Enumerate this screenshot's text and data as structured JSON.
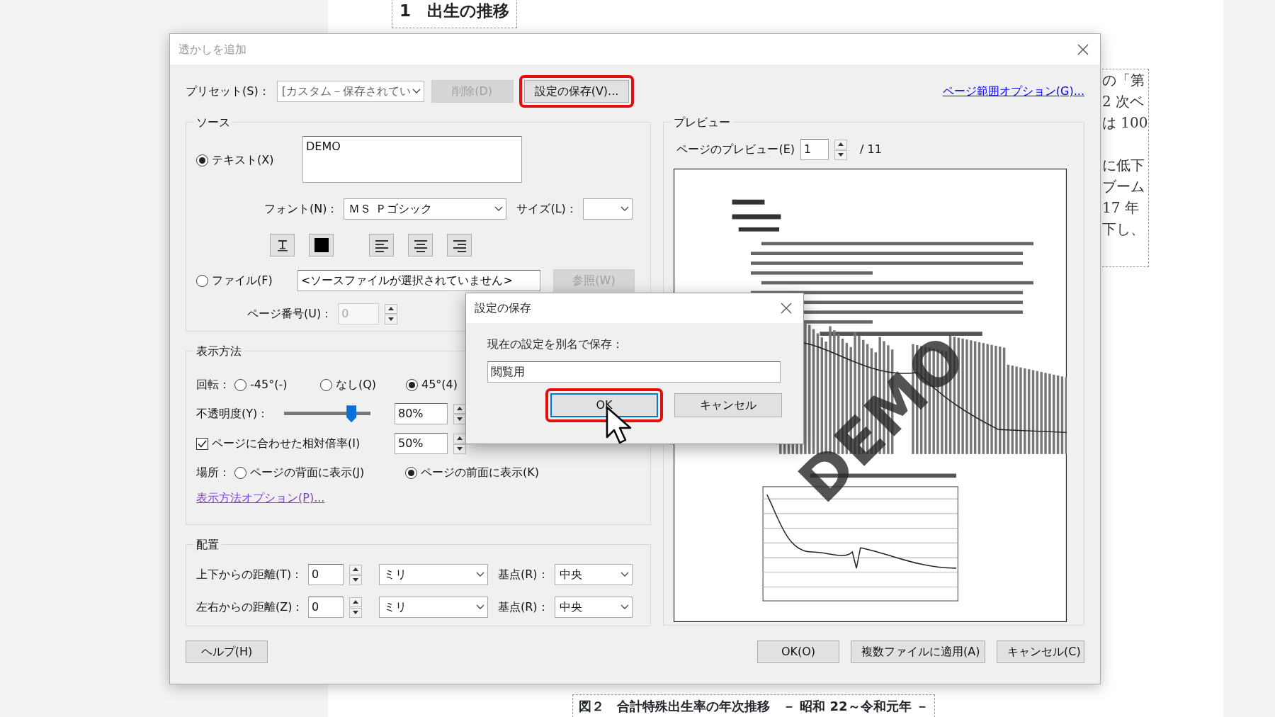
{
  "document": {
    "heading": "1　出生の推移",
    "side_paragraphs": [
      [
        "の「第",
        "2 次ベ",
        "は 100"
      ],
      [
        "に低下",
        "ブーム",
        "17 年",
        "下し、"
      ]
    ],
    "caption": "図２　合計特殊出生率の年次推移　－ 昭和 22～令和元年 －"
  },
  "dialog": {
    "title": "透かしを追加",
    "preset": {
      "label": "プリセット(S)：",
      "value": "[カスタム－保存されてい"
    },
    "toolbar_buttons": [
      {
        "label": "削除(D)",
        "disabled": true,
        "highlighted": false
      },
      {
        "label": "設定の保存(V)...",
        "disabled": false,
        "highlighted": true
      }
    ],
    "page_range_link": "ページ範囲オプション(G)...",
    "source": {
      "title": "ソース",
      "text_option": {
        "label": "テキスト(X)",
        "selected": true
      },
      "text_value": "DEMO",
      "font": {
        "label": "フォント(N)：",
        "value": "ＭＳ Ｐゴシック"
      },
      "size_label": "サイズ(L)：",
      "file_option": {
        "label": "ファイル(F)",
        "selected": false
      },
      "file_value": "<ソースファイルが選択されていません>",
      "browse_button": {
        "label": "参照(W)",
        "disabled": true
      },
      "page_number": {
        "label": "ページ番号(U)：",
        "value": "0",
        "disabled": true
      }
    },
    "appearance": {
      "title": "表示方法",
      "rotation_label": "回転：",
      "rotation_options": [
        {
          "label": "-45°(-)",
          "selected": false
        },
        {
          "label": "なし(Q)",
          "selected": false
        },
        {
          "label": "45°(4)",
          "selected": true
        }
      ],
      "opacity": {
        "label": "不透明度(Y)：",
        "level": 0.78,
        "value": "80%"
      },
      "scale": {
        "label": "ページに合わせた相対倍率(I)",
        "checked": true,
        "value": "50%"
      },
      "location_label": "場所：",
      "location_options": [
        {
          "label": "ページの背面に表示(J)",
          "selected": false
        },
        {
          "label": "ページの前面に表示(K)",
          "selected": true
        }
      ],
      "options_link": "表示方法オプション(P)..."
    },
    "position": {
      "title": "配置",
      "rows": [
        {
          "label": "上下からの距離(T)：",
          "value": "0",
          "unit": "ミリ",
          "anchor_label": "基点(R)：",
          "anchor": "中央"
        },
        {
          "label": "左右からの距離(Z)：",
          "value": "0",
          "unit": "ミリ",
          "anchor_label": "基点(R)：",
          "anchor": "中央"
        }
      ]
    },
    "preview": {
      "title": "プレビュー",
      "page_label": "ページのプレビュー(E)",
      "page": "1",
      "total": "/ 11",
      "watermark": "DEMO"
    },
    "help_button": "ヘルプ(H)",
    "buttons": [
      "OK(O)",
      "複数ファイルに適用(A)",
      "キャンセル(C)"
    ]
  },
  "save_dialog": {
    "title": "設定の保存",
    "prompt": "現在の設定を別名で保存：",
    "value": "閲覧用",
    "buttons": [
      {
        "label": "OK",
        "highlighted": true,
        "focused": true
      },
      {
        "label": "キャンセル",
        "highlighted": false,
        "focused": false
      }
    ]
  }
}
